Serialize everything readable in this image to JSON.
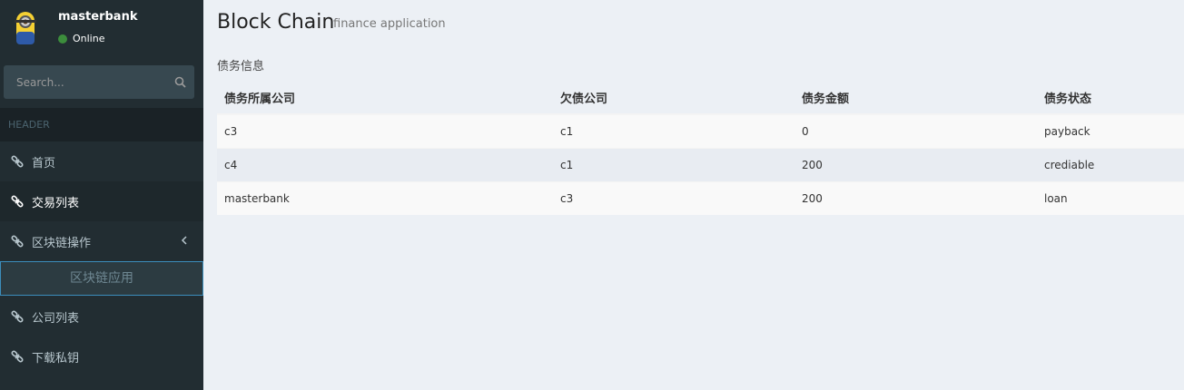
{
  "user": {
    "name": "masterbank",
    "status": "Online"
  },
  "search": {
    "placeholder": "Search..."
  },
  "sidebar": {
    "header": "HEADER",
    "items": [
      {
        "label": "首页"
      },
      {
        "label": "交易列表"
      },
      {
        "label": "区块链操作"
      },
      {
        "label": "区块链应用"
      },
      {
        "label": "公司列表"
      },
      {
        "label": "下载私钥"
      }
    ]
  },
  "page": {
    "title": "Block Chain",
    "subtitle": "finance application",
    "section": "债务信息"
  },
  "table": {
    "headers": [
      "债务所属公司",
      "欠债公司",
      "债务金额",
      "债务状态"
    ],
    "rows": [
      [
        "c3",
        "c1",
        "0",
        "payback"
      ],
      [
        "c4",
        "c1",
        "200",
        "crediable"
      ],
      [
        "masterbank",
        "c3",
        "200",
        "loan"
      ]
    ]
  },
  "colors": {
    "sidebar": "#222d32",
    "accent": "#3c8dbc",
    "online": "#3c8d3c"
  },
  "icons": {
    "menu": "link-icon",
    "search": "search-icon",
    "expand": "chevron-left-icon"
  }
}
